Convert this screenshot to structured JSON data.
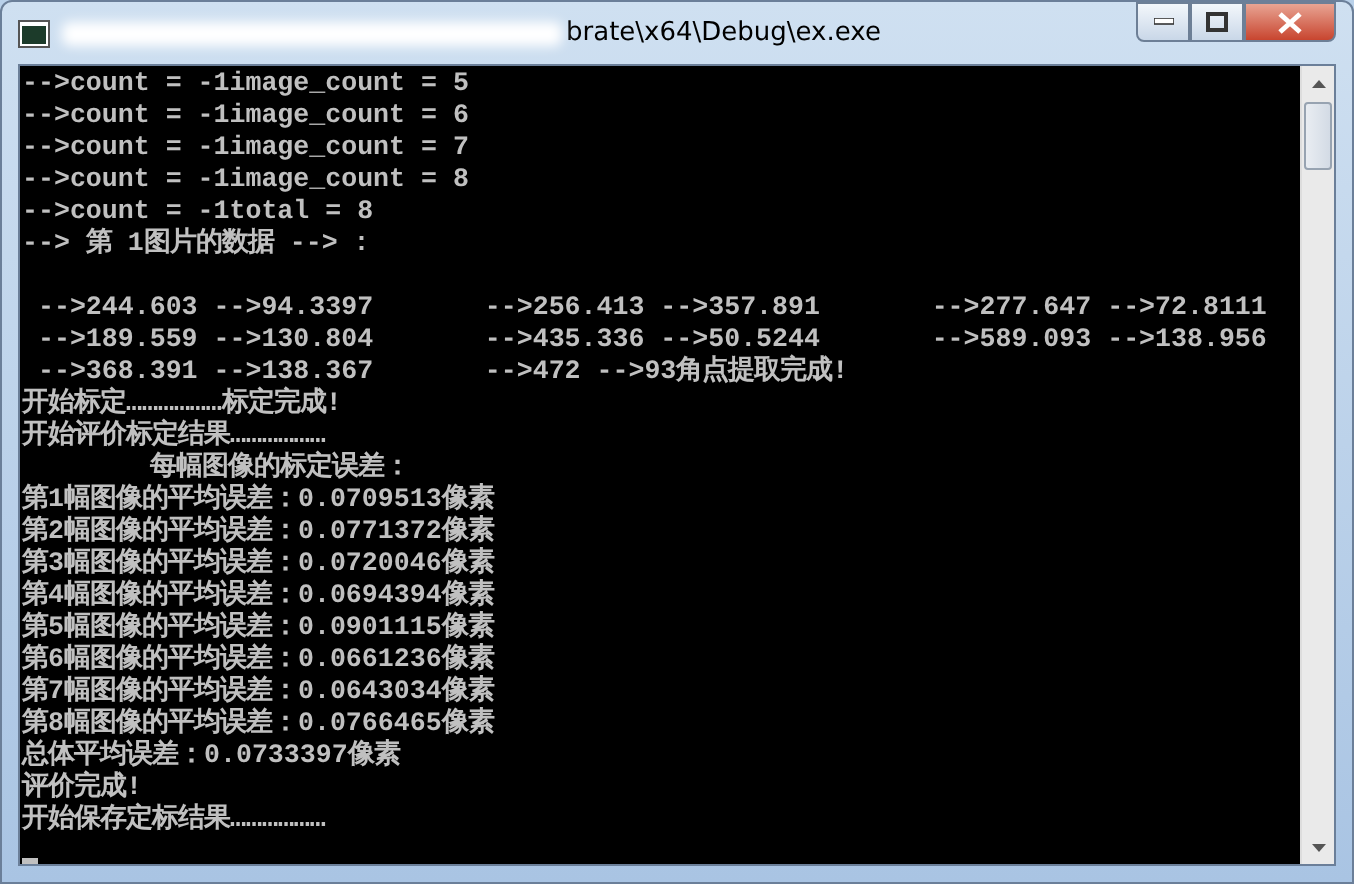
{
  "window": {
    "title": "brate\\x64\\Debug\\ex.exe"
  },
  "console": {
    "blocks": [
      [
        "-->count = -1image_count = 5",
        "-->count = -1image_count = 6",
        "-->count = -1image_count = 7",
        "-->count = -1image_count = 8",
        "-->count = -1total = 8",
        "--> 第 1图片的数据 --> :"
      ],
      [
        " -->244.603 -->94.3397       -->256.413 -->357.891       -->277.647 -->72.8111",
        " -->189.559 -->130.804       -->435.336 -->50.5244       -->589.093 -->138.956",
        " -->368.391 -->138.367       -->472 -->93角点提取完成!",
        "开始标定………………标定完成!",
        "开始评价标定结果………………",
        "        每幅图像的标定误差：",
        "第1幅图像的平均误差：0.0709513像素",
        "第2幅图像的平均误差：0.0771372像素",
        "第3幅图像的平均误差：0.0720046像素",
        "第4幅图像的平均误差：0.0694394像素",
        "第5幅图像的平均误差：0.0901115像素",
        "第6幅图像的平均误差：0.0661236像素",
        "第7幅图像的平均误差：0.0643034像素",
        "第8幅图像的平均误差：0.0766465像素",
        "总体平均误差：0.0733397像素",
        "评价完成!",
        "开始保存定标结果………………"
      ]
    ]
  }
}
